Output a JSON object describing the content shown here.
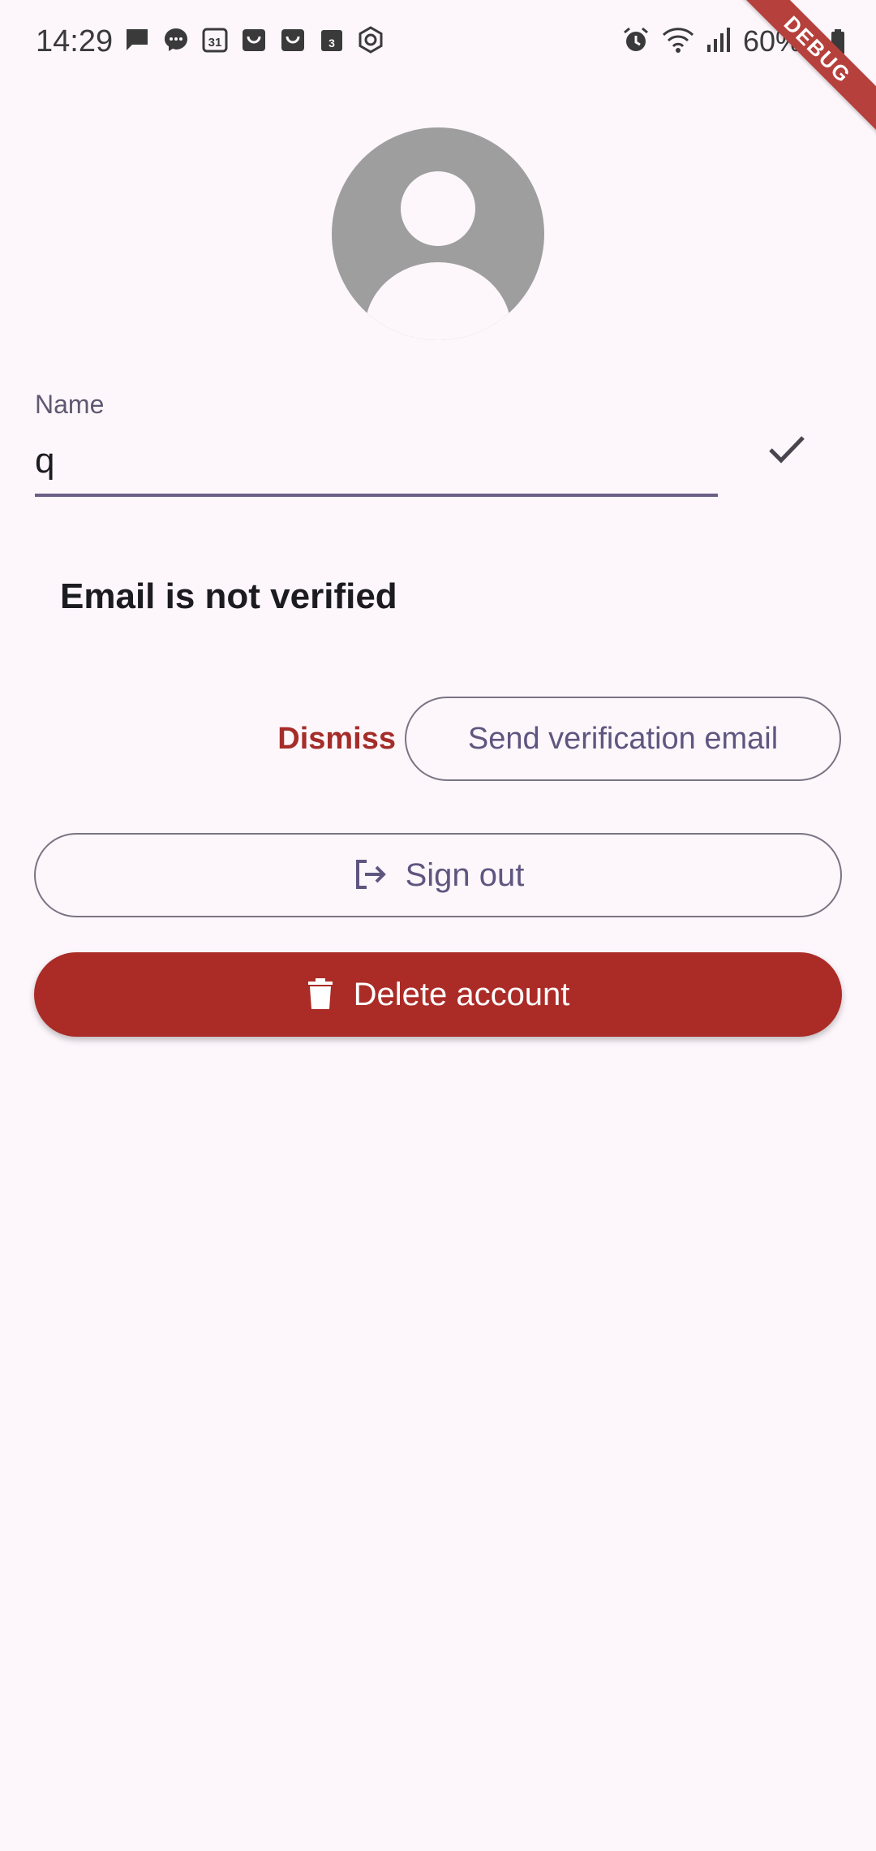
{
  "status_bar": {
    "time": "14:29",
    "battery": "60%",
    "notification_icons": [
      "chat-icon",
      "messenger-icon",
      "calendar-icon",
      "shopping-bag-icon",
      "shopping-bag-icon",
      "calendar-badge-icon",
      "hexagon-app-icon"
    ],
    "system_icons": [
      "alarm-icon",
      "wifi-icon",
      "signal-icon",
      "battery-icon"
    ],
    "calendar_day": "31",
    "badge_number": "3"
  },
  "debug_banner": "DEBUG",
  "profile": {
    "avatar_icon": "account-circle-icon",
    "name_label": "Name",
    "name_value": "q",
    "confirm_icon": "check-icon"
  },
  "email_verification": {
    "message": "Email is not verified",
    "dismiss_label": "Dismiss",
    "send_label": "Send verification email"
  },
  "actions": {
    "sign_out_label": "Sign out",
    "sign_out_icon": "logout-icon",
    "delete_label": "Delete account",
    "delete_icon": "trash-icon"
  },
  "colors": {
    "background": "#fdf7fc",
    "primary": "#6c5e86",
    "error": "#ab2b26",
    "avatar": "#9e9e9e"
  }
}
